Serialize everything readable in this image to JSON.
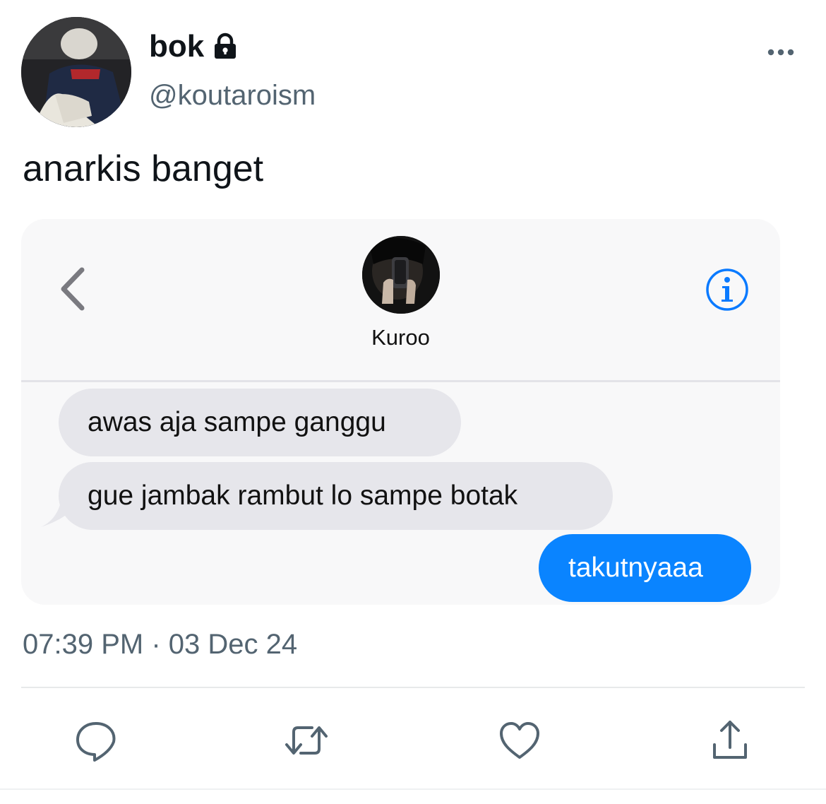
{
  "author": {
    "display_name": "bok",
    "handle": "@koutaroism",
    "protected": true,
    "avatar_icon": "user-avatar-photo"
  },
  "tweet": {
    "text": "anarkis banget",
    "timestamp": "07:39 PM · 03 Dec 24"
  },
  "chat": {
    "contact_name": "Kuroo",
    "messages": [
      {
        "direction": "incoming",
        "text": "awas aja sampe ganggu"
      },
      {
        "direction": "incoming",
        "text": "gue jambak rambut lo sampe botak"
      },
      {
        "direction": "outgoing",
        "text": "takutnyaaa"
      }
    ]
  },
  "colors": {
    "text_primary": "#0f1419",
    "text_secondary": "#536471",
    "imessage_blue": "#0a84ff",
    "incoming_bubble": "#e6e6eb",
    "chat_background": "#f8f8f9",
    "ios_accent": "#0a7aff"
  },
  "actions": [
    "reply-icon",
    "retweet-icon",
    "like-icon",
    "share-icon"
  ]
}
